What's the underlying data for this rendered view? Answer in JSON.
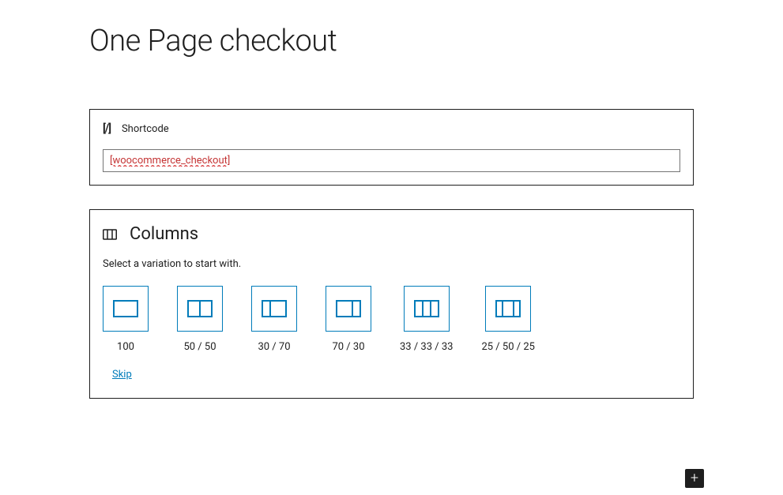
{
  "page": {
    "title": "One Page checkout"
  },
  "shortcode_block": {
    "label": "Shortcode",
    "value": "[woocommerce_checkout]"
  },
  "columns_block": {
    "title": "Columns",
    "description": "Select a variation to start with.",
    "variations": [
      {
        "label": "100"
      },
      {
        "label": "50 / 50"
      },
      {
        "label": "30 / 70"
      },
      {
        "label": "70 / 30"
      },
      {
        "label": "33 / 33 / 33"
      },
      {
        "label": "25 / 50 / 25"
      }
    ],
    "skip_label": "Skip"
  },
  "colors": {
    "accent": "#007cba",
    "text": "#1e1e1e",
    "border": "#1e1e1e",
    "input_border": "#757575",
    "error_text": "#c43535"
  }
}
